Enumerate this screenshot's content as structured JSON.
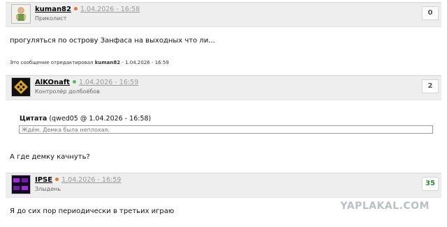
{
  "posts": [
    {
      "username": "kuman82",
      "status_color": "#e8742e",
      "date": "1.04.2026 - 16:58",
      "rank": "Приколист",
      "score": "0",
      "text": "прогуляться по острову Занфаса на выходных что ли...",
      "edited_prefix": "Это сообщение отредактировал",
      "edited_user": "kuman82",
      "edited_date": "- 1.04.2026 - 16:59"
    },
    {
      "username": "AlKOnaft",
      "status_color": "#5cb85c",
      "date": "1.04.2026 - 16:59",
      "rank": "Контролёр долбоёбов",
      "score": "2",
      "quote_label": "Цитата",
      "quote_source": "(qwed05 @ 1.04.2026 - 16:58)",
      "quote_text": "Ждём. Демка была неплохая.",
      "text": "А где демку качнуть?"
    },
    {
      "username": "IPSE",
      "status_color": "#e8742e",
      "date": "1.04.2026 - 16:59",
      "rank": "Злыдень",
      "score": "35",
      "text": "Я до сих пор периодически в третьих играю"
    }
  ],
  "watermark": "YAPLAKAL.COM"
}
